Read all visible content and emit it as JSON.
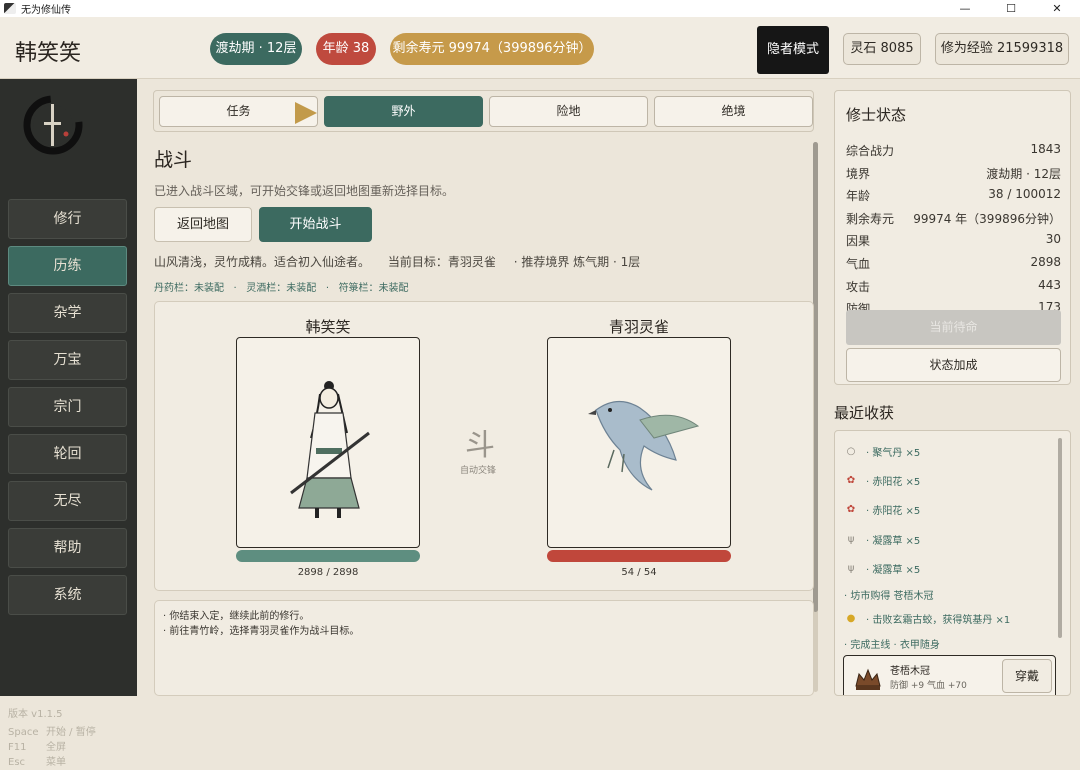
{
  "window": {
    "title": "无为修仙传",
    "minimize": "—",
    "maximize": "☐",
    "close": "✕"
  },
  "header": {
    "char_name": "韩笑笑",
    "realm_pill": "渡劫期 · 12层",
    "age_pill": "年龄 38",
    "lifespan_pill": "剩余寿元 99974（399896分钟）",
    "hermit_button": "隐者模式",
    "spirit_stone": "灵石 8085",
    "cultivation_exp": "修为经验 21599318"
  },
  "sidebar": {
    "items": [
      {
        "label": "修行",
        "active": false
      },
      {
        "label": "历练",
        "active": true
      },
      {
        "label": "杂学",
        "active": false
      },
      {
        "label": "万宝",
        "active": false
      },
      {
        "label": "宗门",
        "active": false
      },
      {
        "label": "轮回",
        "active": false
      },
      {
        "label": "无尽",
        "active": false
      },
      {
        "label": "帮助",
        "active": false
      },
      {
        "label": "系统",
        "active": false
      }
    ],
    "version": "版本 v1.1.5",
    "keys": [
      {
        "key": "Space",
        "action": "开始 / 暂停"
      },
      {
        "key": "F11",
        "action": "全屏"
      },
      {
        "key": "Esc",
        "action": "菜单"
      }
    ]
  },
  "tabs": [
    {
      "label": "任务",
      "active": false
    },
    {
      "label": "野外",
      "active": true
    },
    {
      "label": "险地",
      "active": false
    },
    {
      "label": "绝境",
      "active": false
    }
  ],
  "battle": {
    "title": "战斗",
    "description": "已进入战斗区域，可开始交锋或返回地图重新选择目标。",
    "return_button": "返回地图",
    "fight_button": "开始战斗",
    "env": "山风清浅，灵竹成精。适合初入仙途者。",
    "target": "当前目标：青羽灵雀",
    "recommend": "·    推荐境界 炼气期 · 1层",
    "equip": {
      "pill": "丹药栏：未装配",
      "wine": "灵酒栏：未装配",
      "talisman": "符箓栏：未装配"
    },
    "player": {
      "name": "韩笑笑",
      "hp_text": "2898 / 2898",
      "hp_fraction": 1.0,
      "bar_color": "#5e8e80"
    },
    "enemy": {
      "name": "青羽灵雀",
      "hp_text": "54 / 54",
      "hp_fraction": 1.0,
      "bar_color": "#c0473b"
    },
    "vs": "斗",
    "auto": "自动交锋",
    "log": [
      "· 你结束入定，继续此前的修行。",
      "· 前往青竹岭，选择青羽灵雀作为战斗目标。"
    ]
  },
  "status": {
    "title": "修士状态",
    "rows": [
      {
        "label": "综合战力",
        "value": "1843"
      },
      {
        "label": "境界",
        "value": "渡劫期 · 12层"
      },
      {
        "label": "年龄",
        "value": "38 / 100012"
      },
      {
        "label": "剩余寿元",
        "value": "99974 年（399896分钟）"
      },
      {
        "label": "因果",
        "value": "30"
      },
      {
        "label": "气血",
        "value": "2898"
      },
      {
        "label": "攻击",
        "value": "443"
      },
      {
        "label": "防御",
        "value": "173"
      }
    ],
    "disabled_button": "当前待命",
    "bonus_button": "状态加成"
  },
  "recent": {
    "title": "最近收获",
    "items": [
      {
        "icon": "pill-icon",
        "glyph": "○",
        "text": "· 聚气丹 ×5"
      },
      {
        "icon": "flower-icon",
        "glyph": "✿",
        "text": "· 赤阳花 ×5"
      },
      {
        "icon": "flower-icon",
        "glyph": "✿",
        "text": "· 赤阳花 ×5"
      },
      {
        "icon": "herb-icon",
        "glyph": "ψ",
        "text": "· 凝露草 ×5"
      },
      {
        "icon": "herb-icon",
        "glyph": "ψ",
        "text": "· 凝露草 ×5"
      },
      {
        "icon": "",
        "glyph": "",
        "text": "· 坊市购得 苍梧木冠"
      },
      {
        "icon": "coin-icon",
        "glyph": "●",
        "text": "· 击败玄霜古蛟，获得筑基丹 ×1"
      },
      {
        "icon": "",
        "glyph": "",
        "text": "· 完成主线 · 衣甲随身"
      }
    ],
    "card": {
      "name": "苍梧木冠",
      "stats": "防御 +9   气血 +70",
      "wear_button": "穿戴"
    }
  }
}
